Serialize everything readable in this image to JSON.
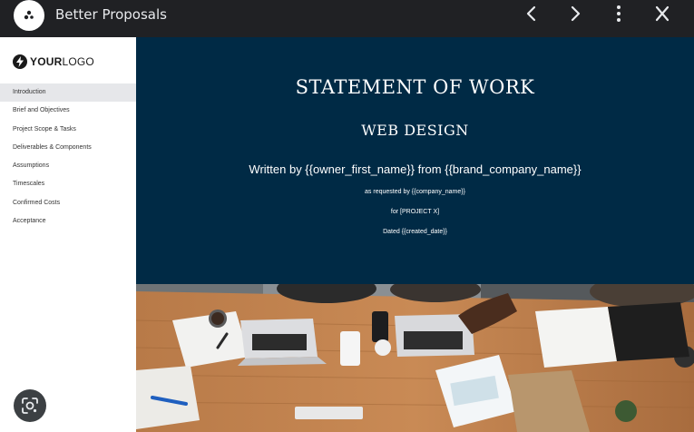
{
  "window": {
    "title": "Better Proposals"
  },
  "sidebar": {
    "logo": {
      "bold": "YOUR",
      "light": "LOGO"
    },
    "items": [
      {
        "label": "Introduction",
        "active": true
      },
      {
        "label": "Brief and Objectives"
      },
      {
        "label": "Project Scope & Tasks"
      },
      {
        "label": "Deliverables & Components"
      },
      {
        "label": "Assumptions"
      },
      {
        "label": "Timescales"
      },
      {
        "label": "Confirmed Costs"
      },
      {
        "label": "Acceptance"
      }
    ]
  },
  "document": {
    "title": "STATEMENT OF WORK",
    "subtitle": "WEB DESIGN",
    "written_by": "Written by {{owner_first_name}} from {{brand_company_name}}",
    "requested_by": "as requested by {{company_name}}",
    "for_project": "for [PROJECT X]",
    "dated": "Dated {{created_date}}"
  },
  "colors": {
    "hero_background": "#002a45",
    "topbar_background": "#202124",
    "active_item_background": "#e6e7ea"
  },
  "icons": {
    "app": "better-proposals-icon",
    "back": "chevron-left-icon",
    "forward": "chevron-right-icon",
    "menu": "more-vert-icon",
    "close": "close-icon",
    "lens": "google-lens-icon"
  }
}
